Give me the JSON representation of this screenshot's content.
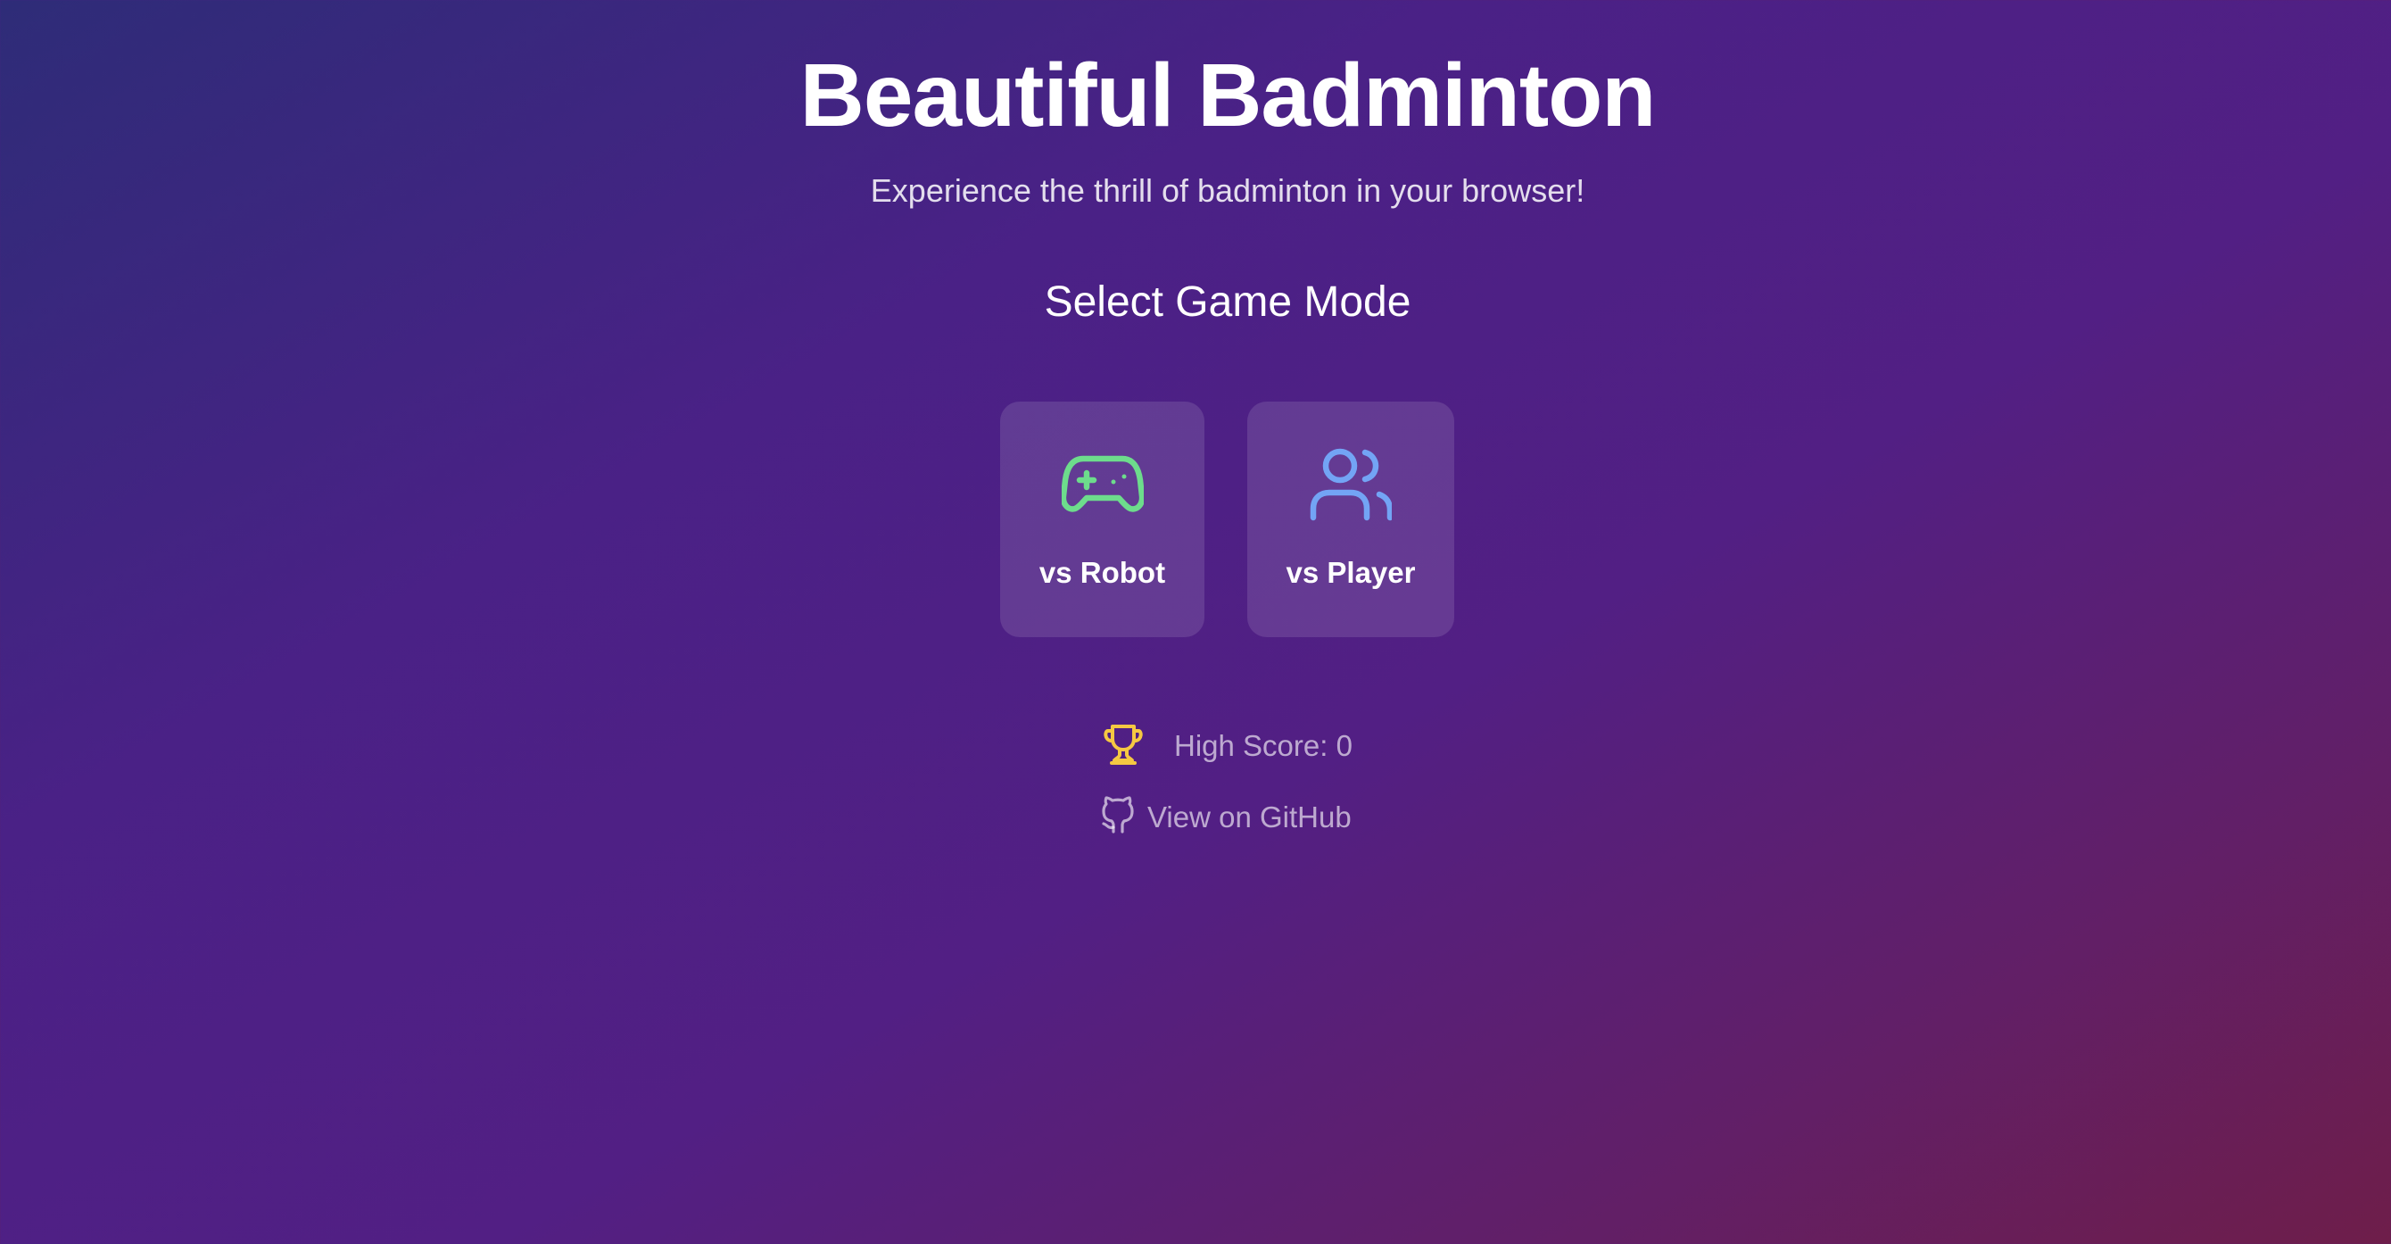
{
  "header": {
    "title": "Beautiful Badminton",
    "subtitle": "Experience the thrill of badminton in your browser!"
  },
  "mode_select": {
    "heading": "Select Game Mode",
    "options": [
      {
        "label": "vs Robot",
        "icon": "gamepad-icon",
        "icon_color": "#6ddc8c"
      },
      {
        "label": "vs Player",
        "icon": "users-icon",
        "icon_color": "#73a4f5"
      }
    ]
  },
  "footer": {
    "high_score_text": "High Score: 0",
    "trophy_icon_color": "#f5c842",
    "github_link_text": "View on GitHub"
  },
  "colors": {
    "background_start": "#2e2c78",
    "background_mid": "#521f84",
    "background_end": "#6e1e4a",
    "card_background": "rgba(255,255,255,0.12)"
  }
}
